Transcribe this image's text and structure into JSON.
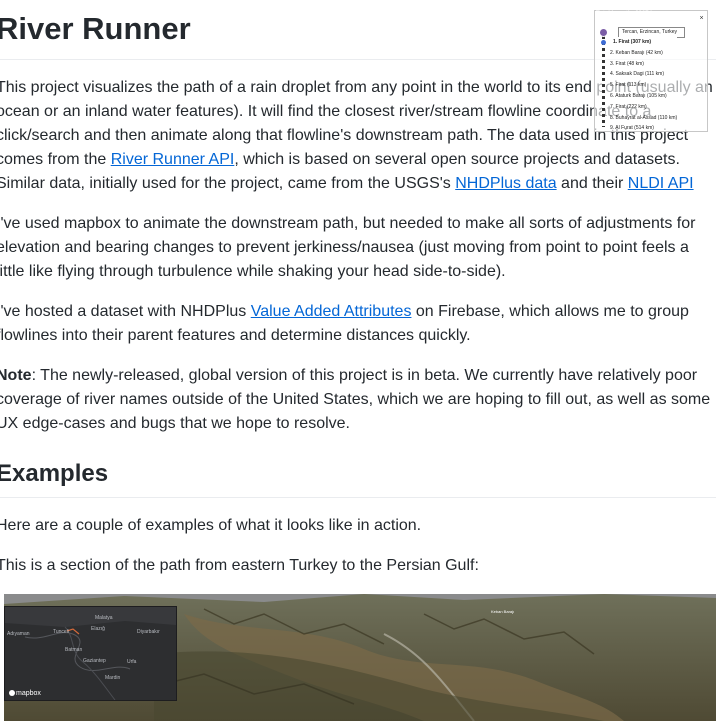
{
  "page": {
    "title": "River Runner"
  },
  "intro": {
    "t1": "This project visualizes the path of a rain droplet from any point in the world to its end point (usually an ocean or an inland water features). It will find the closest river/stream flowline coordinate to a click/search and then animate along that flowline's downstream path. The data used in this project comes from the ",
    "link1": "River Runner API",
    "t2": ", which is based on several open source projects and datasets. Similar data, initially used for the project, came from the USGS's ",
    "link2": "NHDPlus data",
    "t3": " and their ",
    "link3": "NLDI API"
  },
  "para2": {
    "text": "I've used mapbox to animate the downstream path, but needed to make all sorts of adjustments for elevation and bearing changes to prevent jerkiness/nausea (just moving from point to point feels a little like flying through turbulence while shaking your head side-to-side)."
  },
  "para3": {
    "t1": "I've hosted a dataset with NHDPlus ",
    "link": "Value Added Attributes",
    "t2": " on Firebase, which allows me to group flowlines into their parent features and determine distances quickly."
  },
  "note": {
    "label": "Note",
    "text": ": The newly-released, global version of this project is in beta. We currently have relatively poor coverage of river names outside of the United States, which we are hoping to fill out, as well as some UX edge-cases and bugs that we hope to resolve."
  },
  "examples": {
    "heading": "Examples",
    "intro": "Here are a couple of examples of what it looks like in action.",
    "caption": "This is a section of the path from eastern Turkey to the Persian Gulf:"
  },
  "map": {
    "inset_labels": [
      "Tunceli",
      "Malatya",
      "Elazığ",
      "Adıyaman",
      "Diyarbakır",
      "Batman",
      "Gaziantep",
      "Urfa",
      "Mardin"
    ],
    "logo": "mapbox",
    "map_label": "Keban Barajı",
    "panel": {
      "total": "Total Length: 2867 km",
      "start": "Tercan, Erzincan, Turkey",
      "close": "×",
      "items": [
        "1. Firat (307 km)",
        "2. Keban Barajı (42 km)",
        "3. Firat (48 km)",
        "4. Saksak Dagi (111 km)",
        "5. Firat (113 km)",
        "6. Ataturk Barajı (105 km)",
        "7. Firat (222 km)",
        "8. Buhayrat al-Assad (110 km)",
        "9. Al Furat (514 km)"
      ]
    }
  },
  "colors": {
    "link": "#0366d6",
    "text": "#24292e",
    "rule": "#eaecef",
    "route": "#7b5da6"
  }
}
